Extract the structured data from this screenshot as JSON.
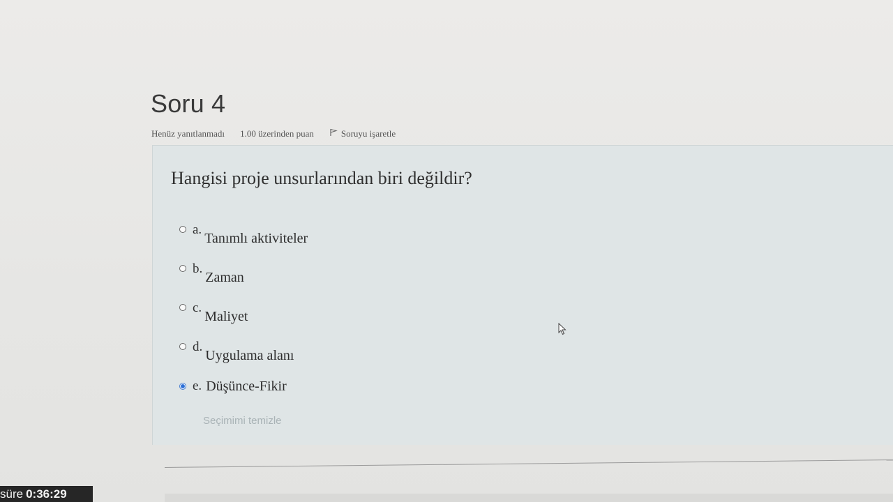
{
  "question": {
    "title": "Soru 4",
    "status": "Henüz yanıtlanmadı",
    "points": "1.00 üzerinden puan",
    "flag_label": "Soruyu işaretle",
    "text": "Hangisi proje unsurlarından biri değildir?",
    "answers": [
      {
        "letter": "a.",
        "label": "Tanımlı aktiviteler",
        "selected": false
      },
      {
        "letter": "b.",
        "label": "Zaman",
        "selected": false
      },
      {
        "letter": "c.",
        "label": "Maliyet",
        "selected": false
      },
      {
        "letter": "d.",
        "label": "Uygulama alanı",
        "selected": false
      },
      {
        "letter": "e.",
        "label": "Düşünce-Fikir",
        "selected": true
      }
    ],
    "clear_label": "Seçimimi temizle"
  },
  "timer": {
    "label": "süre",
    "value": "0:36:29"
  },
  "icons": {
    "flag": "flag-icon",
    "cursor": "mouse-pointer-icon"
  }
}
